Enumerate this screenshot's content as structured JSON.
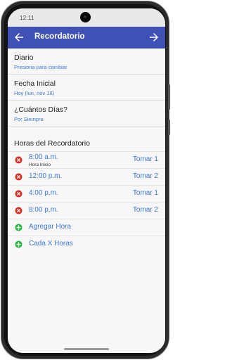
{
  "status_bar": {
    "time": "12:11"
  },
  "app_bar": {
    "title": "Recordatorio",
    "back_icon": "arrow-left-icon",
    "forward_icon": "arrow-right-icon",
    "background_color": "#3f51b5"
  },
  "settings": [
    {
      "title": "Diario",
      "subtitle": "Presiona para cambiar"
    },
    {
      "title": "Fecha Inicial",
      "subtitle": "Hoy (lun, nov 18)"
    },
    {
      "title": "¿Cuántos Días?",
      "subtitle": "Por Siempre"
    }
  ],
  "reminders": {
    "section_title": "Horas del Recordatorio",
    "remove_icon": "remove-circle-icon",
    "items": [
      {
        "time": "8:00 a.m.",
        "hint": "Hora Inicio",
        "dose": "Tomar 1"
      },
      {
        "time": "12:00 p.m.",
        "dose": "Tomar 2"
      },
      {
        "time": "4:00 p.m.",
        "dose": "Tomar 1"
      },
      {
        "time": "8:00 p.m.",
        "dose": "Tomar 2"
      }
    ],
    "actions": [
      {
        "label": "Agregar Hora",
        "icon": "add-circle-icon"
      },
      {
        "label": "Cada X Horas",
        "icon": "add-circle-icon"
      }
    ],
    "accent_color": "#3c78d8",
    "remove_color": "#d93025",
    "add_color": "#2fb344"
  }
}
